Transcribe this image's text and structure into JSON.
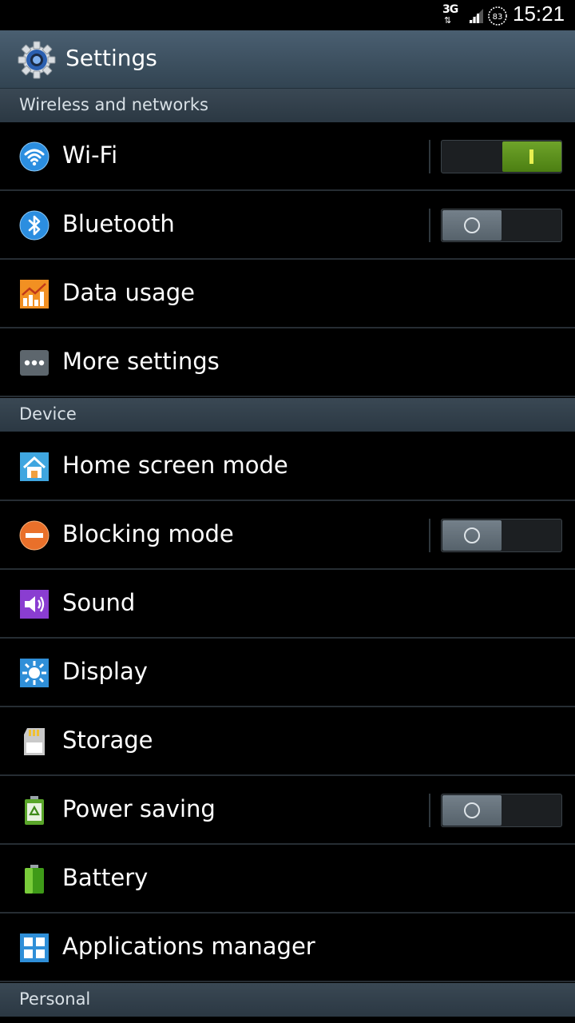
{
  "status_bar": {
    "network": "3G",
    "network_arrows": "⇅",
    "battery_level": "83",
    "time": "15:21"
  },
  "action_bar": {
    "title": "Settings"
  },
  "sections": {
    "wireless": "Wireless and networks",
    "device": "Device",
    "personal": "Personal"
  },
  "items": {
    "wifi": {
      "label": "Wi-Fi",
      "toggle": true
    },
    "bluetooth": {
      "label": "Bluetooth",
      "toggle": false
    },
    "data_usage": {
      "label": "Data usage"
    },
    "more_settings": {
      "label": "More settings"
    },
    "home_screen_mode": {
      "label": "Home screen mode"
    },
    "blocking_mode": {
      "label": "Blocking mode",
      "toggle": false
    },
    "sound": {
      "label": "Sound"
    },
    "display": {
      "label": "Display"
    },
    "storage": {
      "label": "Storage"
    },
    "power_saving": {
      "label": "Power saving",
      "toggle": false
    },
    "battery": {
      "label": "Battery"
    },
    "applications_manager": {
      "label": "Applications manager"
    }
  },
  "colors": {
    "toggle_on": "#5e9620",
    "toggle_off": "#6a7680",
    "section_bg": "#34424d",
    "action_bar_bg": "#405466"
  }
}
